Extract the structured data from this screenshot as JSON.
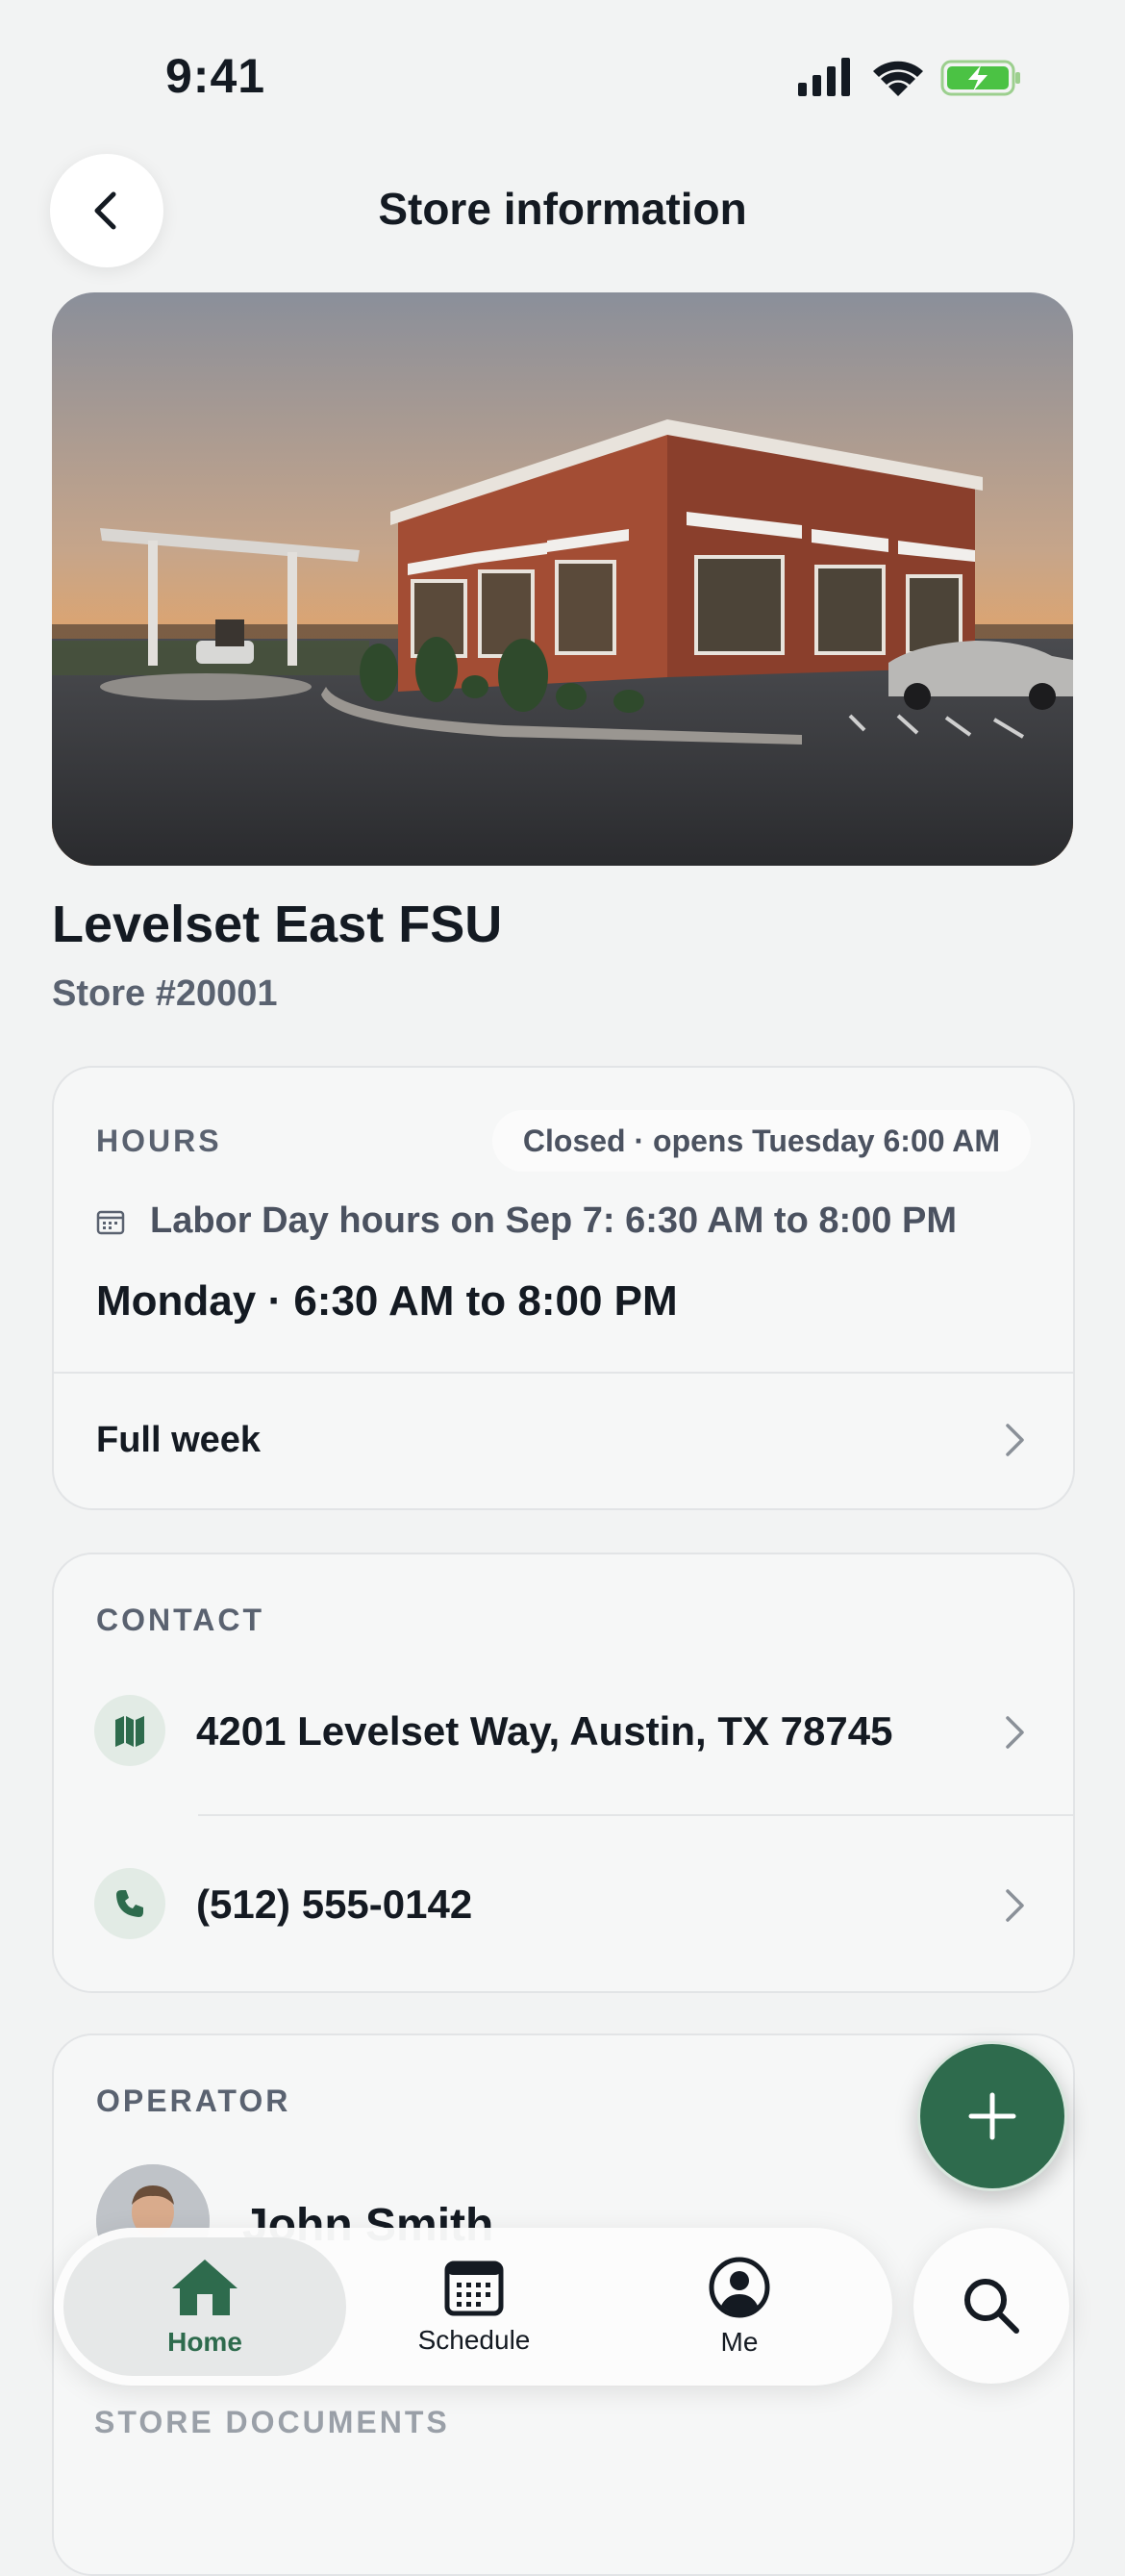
{
  "status_bar": {
    "time": "9:41"
  },
  "header": {
    "title": "Store information"
  },
  "store": {
    "name": "Levelset East FSU",
    "number": "Store #20001"
  },
  "hours": {
    "section_label": "HOURS",
    "status": "Closed · opens Tuesday 6:00 AM",
    "holiday_notice": "Labor Day hours on Sep 7: 6:30 AM to 8:00 PM",
    "today": "Monday · 6:30 AM to 8:00 PM",
    "full_week_label": "Full week"
  },
  "contact": {
    "section_label": "CONTACT",
    "address": "4201 Levelset Way, Austin, TX 78745",
    "phone": "(512) 555-0142"
  },
  "operator": {
    "section_label": "OPERATOR",
    "name": "John Smith"
  },
  "next_section_label": "STORE DOCUMENTS",
  "tabs": [
    {
      "label": "Home",
      "icon": "home-icon",
      "active": true
    },
    {
      "label": "Schedule",
      "icon": "calendar-icon",
      "active": false
    },
    {
      "label": "Me",
      "icon": "profile-icon",
      "active": false
    }
  ],
  "colors": {
    "accent": "#2e6b4d",
    "background": "#f2f3f3"
  }
}
